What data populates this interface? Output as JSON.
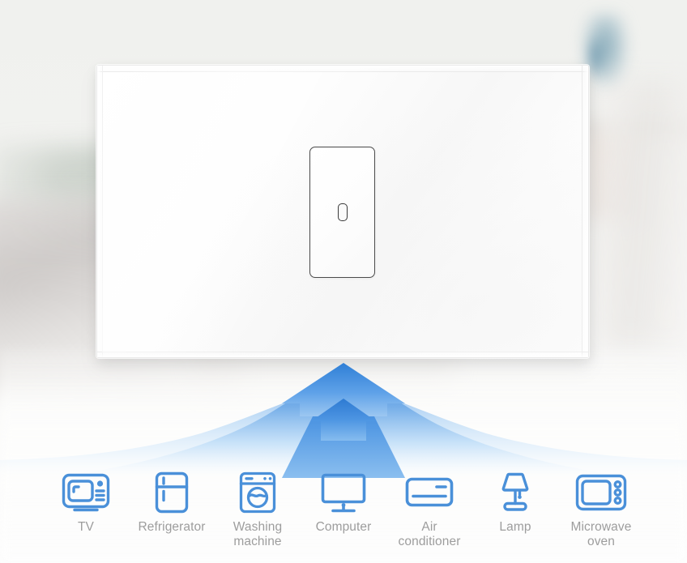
{
  "scene": {
    "title": "Smart wall switch control panel",
    "background_description": "Blurred bright living room interior"
  },
  "panel": {
    "name": "glass-touch-switch-plate",
    "finish": "white tempered glass",
    "gang_count": 1,
    "button": {
      "label": "",
      "indicator": "oval-indicator",
      "state": "off"
    },
    "colors": {
      "plate": "#ffffff",
      "plate_border": "#eaeaea",
      "button_outline": "#4b4b4b",
      "indicator_outline": "#3a3a3a"
    }
  },
  "arrow": {
    "name": "upward-arrow-fan",
    "direction": "up",
    "colors": {
      "top": "#2f7fd6",
      "mid": "#5ea1e8",
      "bottom": "#eaf4fd",
      "fade": "#ffffff"
    }
  },
  "appliances": {
    "icon_color": "#4a90d9",
    "label_color": "#9d9d9d",
    "items": [
      {
        "id": "tv",
        "icon": "tv-icon",
        "label": "TV"
      },
      {
        "id": "refrigerator",
        "icon": "refrigerator-icon",
        "label": "Refrigerator"
      },
      {
        "id": "washing-machine",
        "icon": "washing-machine-icon",
        "label": "Washing\nmachine"
      },
      {
        "id": "computer",
        "icon": "computer-monitor-icon",
        "label": "Computer"
      },
      {
        "id": "air-conditioner",
        "icon": "air-conditioner-icon",
        "label": "Air\nconditioner"
      },
      {
        "id": "lamp",
        "icon": "lamp-icon",
        "label": "Lamp"
      },
      {
        "id": "microwave-oven",
        "icon": "microwave-oven-icon",
        "label": "Microwave\noven"
      }
    ]
  }
}
